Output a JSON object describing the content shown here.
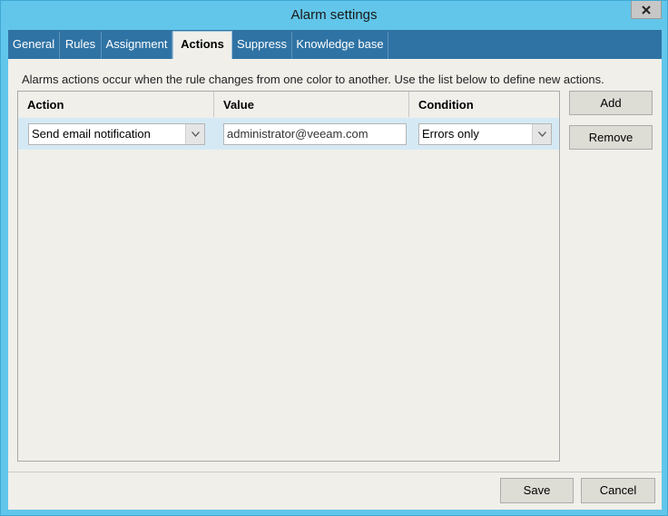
{
  "window": {
    "title": "Alarm settings"
  },
  "tabs": [
    {
      "label": "General"
    },
    {
      "label": "Rules"
    },
    {
      "label": "Assignment"
    },
    {
      "label": "Actions"
    },
    {
      "label": "Suppress"
    },
    {
      "label": "Knowledge base"
    }
  ],
  "active_tab": "Actions",
  "actions": {
    "description": "Alarms actions occur when the rule changes from one color to another. Use the list below to define new actions.",
    "columns": [
      "Action",
      "Value",
      "Condition"
    ],
    "rows": [
      {
        "action": "Send email notification",
        "value": "administrator@veeam.com",
        "condition": "Errors only"
      }
    ],
    "add_label": "Add",
    "remove_label": "Remove"
  },
  "footer": {
    "save_label": "Save",
    "cancel_label": "Cancel"
  },
  "icons": {
    "close": "close-icon",
    "dropdown": "chevron-down-icon"
  },
  "colors": {
    "titlebar": "#62c6ea",
    "tabbar": "#2f73a4",
    "row_selected": "#d5e9f5",
    "panel": "#f0efea"
  }
}
